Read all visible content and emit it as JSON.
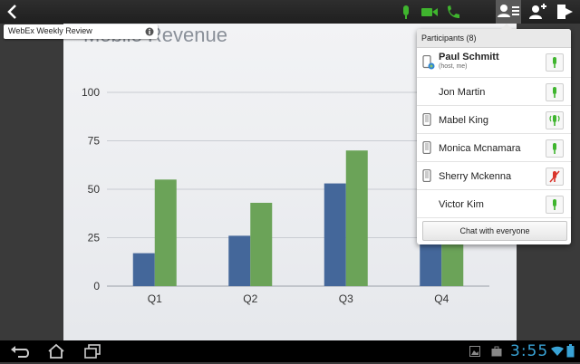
{
  "meeting_title": "WebEx Weekly Review",
  "slide": {
    "title": "Mobile Revenue"
  },
  "chart_data": {
    "type": "bar",
    "title": "Mobile Revenue",
    "categories": [
      "Q1",
      "Q2",
      "Q3",
      "Q4"
    ],
    "series": [
      {
        "values": [
          17,
          26,
          53,
          96
        ],
        "color": "#44679a"
      },
      {
        "values": [
          55,
          43,
          70,
          58
        ],
        "color": "#6ba358"
      }
    ],
    "yticks": [
      "0",
      "25",
      "50",
      "75",
      "100"
    ],
    "ylim": [
      0,
      100
    ],
    "grid": true
  },
  "participants": {
    "header": "Participants (8)",
    "items": [
      {
        "name": "Paul Schmitt",
        "sub": "(host, me)",
        "device": "phone-globe-icon",
        "mic": "mic-on-icon"
      },
      {
        "name": "Jon Martin",
        "device": "",
        "mic": "mic-on-icon"
      },
      {
        "name": "Mabel King",
        "device": "phone-icon",
        "mic": "mic-speaking-icon"
      },
      {
        "name": "Monica Mcnamara",
        "device": "phone-icon",
        "mic": "mic-on-icon"
      },
      {
        "name": "Sherry Mckenna",
        "device": "phone-icon",
        "mic": "mic-muted-icon"
      },
      {
        "name": "Victor Kim",
        "device": "",
        "mic": "mic-on-icon"
      }
    ],
    "chat_button": "Chat with everyone"
  },
  "toolbar": {
    "icons": [
      "back-icon",
      "mic-icon",
      "video-icon",
      "phone-icon",
      "participants-icon",
      "add-participant-icon",
      "leave-meeting-icon"
    ]
  },
  "system_bar": {
    "time": "3:55",
    "icons": [
      "back-icon",
      "home-icon",
      "recent-apps-icon",
      "gallery-icon",
      "briefcase-icon",
      "wifi-icon",
      "battery-icon"
    ]
  },
  "colors": {
    "accent_green": "#3fb52e",
    "mic_red": "#d9342b",
    "clock_blue": "#39a3d6"
  }
}
